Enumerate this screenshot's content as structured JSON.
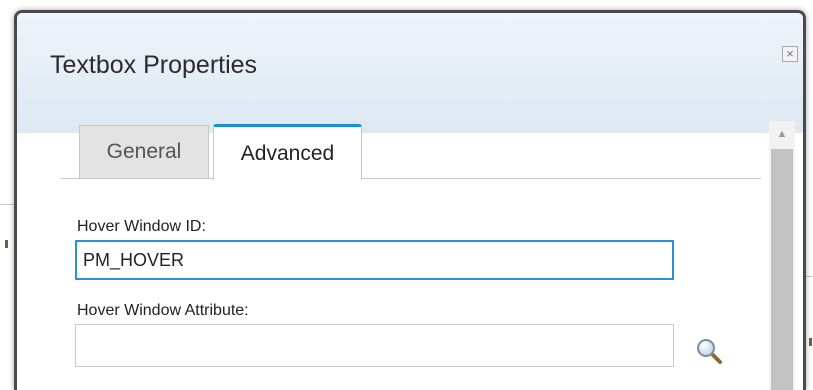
{
  "dialog": {
    "title": "Textbox Properties",
    "close_icon": "close-icon",
    "tabs": [
      {
        "label": "General",
        "active": false
      },
      {
        "label": "Advanced",
        "active": true
      }
    ],
    "fields": {
      "hover_window_id": {
        "label": "Hover Window ID:",
        "value": "PM_HOVER"
      },
      "hover_window_attribute": {
        "label": "Hover Window Attribute:",
        "value": ""
      }
    },
    "lookup_icon": "magnifier-icon",
    "accent_color": "#1a8ed6"
  }
}
